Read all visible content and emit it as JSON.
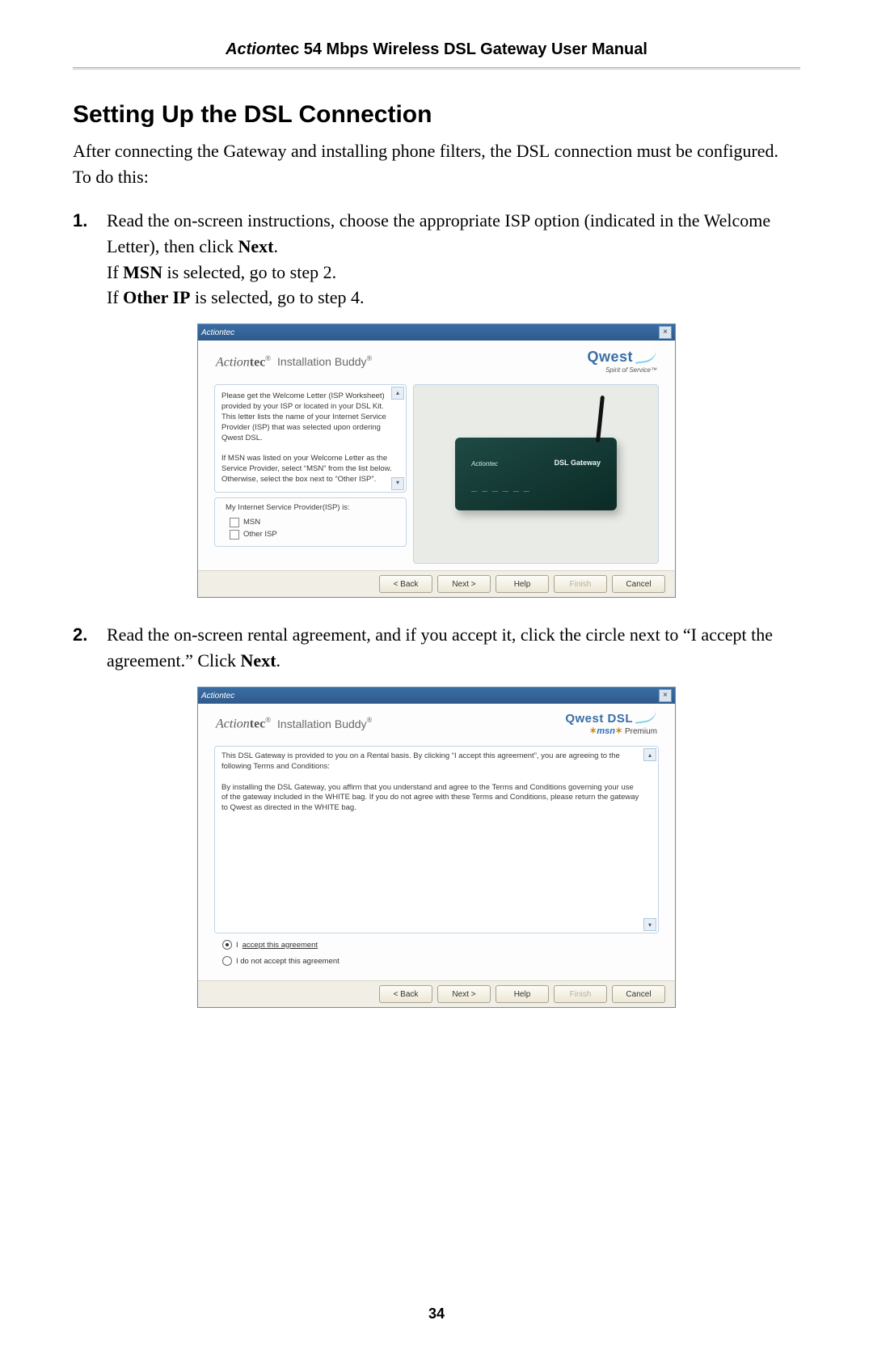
{
  "header": {
    "brand_italic": "Action",
    "brand_rest": "tec 54 Mbps Wireless DSL Gateway User Manual"
  },
  "section_title": "Setting Up the DSL Connection",
  "intro_pre": "After connecting the Gateway and installing phone filters, the ",
  "intro_dsl": "DSL",
  "intro_post": " connection must be configured. To do this:",
  "steps": [
    {
      "num": "1.",
      "line1_pre": "Read the on-screen instructions, choose the appropriate ISP option (indicated in the Welcome Letter), then click ",
      "line1_bold": "Next",
      "line1_post": ".",
      "line2_pre": "If ",
      "line2_bold": "MSN",
      "line2_post": " is selected, go to step 2.",
      "line3_pre": "If ",
      "line3_bold": "Other IP",
      "line3_post": " is selected, go to step 4."
    },
    {
      "num": "2.",
      "line1_pre": "Read the on-screen rental agreement, and if you accept it, click the circle next to “I accept the agreement.” Click ",
      "line1_bold": "Next",
      "line1_post": "."
    }
  ],
  "dialog1": {
    "titlebar": "Actiontec",
    "brand_it": "Action",
    "brand_bold": "tec",
    "brand_tm": "®",
    "brand_sub": " Installation Buddy",
    "brand_sub_tm": "®",
    "qwest": "Qwest",
    "qwest_tag": "Spirit of Service™",
    "para1": "Please get the Welcome Letter (ISP Worksheet) provided by your ISP or located in your DSL Kit. This letter lists the name of your Internet Service Provider (ISP) that was selected upon ordering Qwest DSL.",
    "para2": "If MSN was listed on your Welcome Letter as the Service Provider, select “MSN” from the list below. Otherwise, select the box next to “Other ISP”.",
    "fieldset_legend": "My Internet Service Provider(ISP) is:",
    "opt_msn": "MSN",
    "opt_other": "Other ISP",
    "router_brand": "Actiontec",
    "router_model": "DSL Gateway",
    "buttons": {
      "back": "< Back",
      "next": "Next >",
      "help": "Help",
      "finish": "Finish",
      "cancel": "Cancel"
    }
  },
  "dialog2": {
    "titlebar": "Actiontec",
    "brand_it": "Action",
    "brand_bold": "tec",
    "brand_tm": "®",
    "brand_sub": " Installation Buddy",
    "brand_sub_tm": "®",
    "qwest_dsl": "Qwest DSL",
    "msn": "msn",
    "msn_prem": " Premium",
    "agreement_p1": "This DSL Gateway is provided to you on a Rental basis. By clicking “I accept this agreement”, you are agreeing to the following Terms and Conditions:",
    "agreement_p2": "By installing the DSL Gateway, you affirm that you understand and agree to the Terms and Conditions governing your use of the gateway included in the WHITE bag. If you do not agree with these Terms and Conditions, please return the gateway to Qwest as directed in the WHITE bag.",
    "radio_accept_pre": "I ",
    "radio_accept_u": "accept this agreement",
    "radio_reject": "I do not accept this agreement",
    "buttons": {
      "back": "< Back",
      "next": "Next >",
      "help": "Help",
      "finish": "Finish",
      "cancel": "Cancel"
    }
  },
  "page_number": "34"
}
